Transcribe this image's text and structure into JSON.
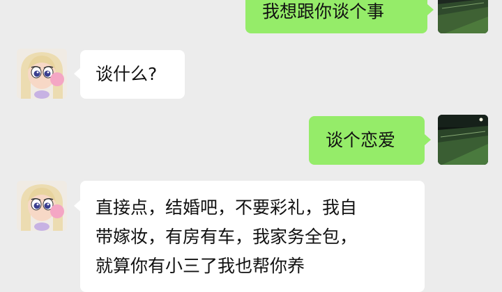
{
  "messages": [
    {
      "sender": "me",
      "avatar": "field-photo-avatar",
      "text": "我想跟你谈个事"
    },
    {
      "sender": "them",
      "avatar": "cartoon-girl-bubblegum-avatar",
      "text": "谈什么?"
    },
    {
      "sender": "me",
      "avatar": "field-photo-avatar",
      "text": "谈个恋爱"
    },
    {
      "sender": "them",
      "avatar": "cartoon-girl-bubblegum-avatar",
      "lines": [
        "直接点，结婚吧，不要彩礼，我自",
        "带嫁妆，有房有车，我家务全包，",
        "就算你有小三了我也帮你养"
      ]
    }
  ],
  "colors": {
    "background": "#ececec",
    "my_bubble": "#95ec69",
    "their_bubble": "#ffffff"
  }
}
